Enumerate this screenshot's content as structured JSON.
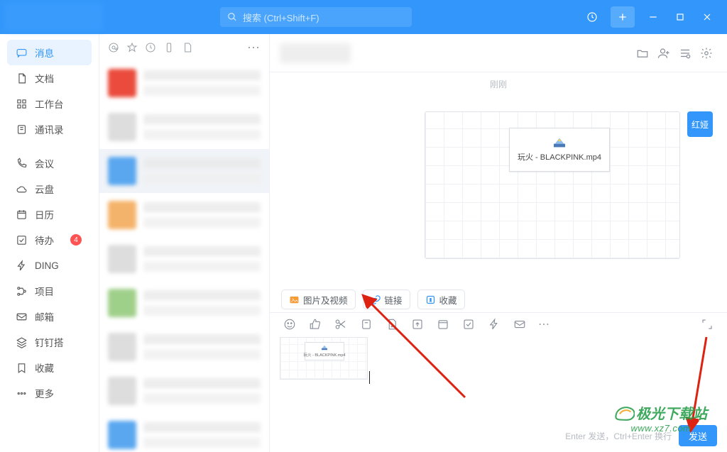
{
  "search": {
    "placeholder": "搜索 (Ctrl+Shift+F)"
  },
  "nav": {
    "items": [
      {
        "label": "消息"
      },
      {
        "label": "文档"
      },
      {
        "label": "工作台"
      },
      {
        "label": "通讯录"
      },
      {
        "label": "会议"
      },
      {
        "label": "云盘"
      },
      {
        "label": "日历"
      },
      {
        "label": "待办",
        "badge": "4"
      },
      {
        "label": "DING"
      },
      {
        "label": "项目"
      },
      {
        "label": "邮箱"
      },
      {
        "label": "钉钉搭"
      },
      {
        "label": "收藏"
      },
      {
        "label": "更多"
      }
    ]
  },
  "chat": {
    "time_tag": "刚刚",
    "file_name": "玩火 - BLACKPINK.mp4",
    "sender_badge": "红娅",
    "attach": {
      "picvid": "图片及视频",
      "link": "链接",
      "fav": "收藏"
    },
    "send_hint": "Enter 发送，Ctrl+Enter 换行",
    "send_btn": "发送"
  },
  "watermark": {
    "line1": "极光下载站",
    "line2": "www.xz7.com"
  }
}
